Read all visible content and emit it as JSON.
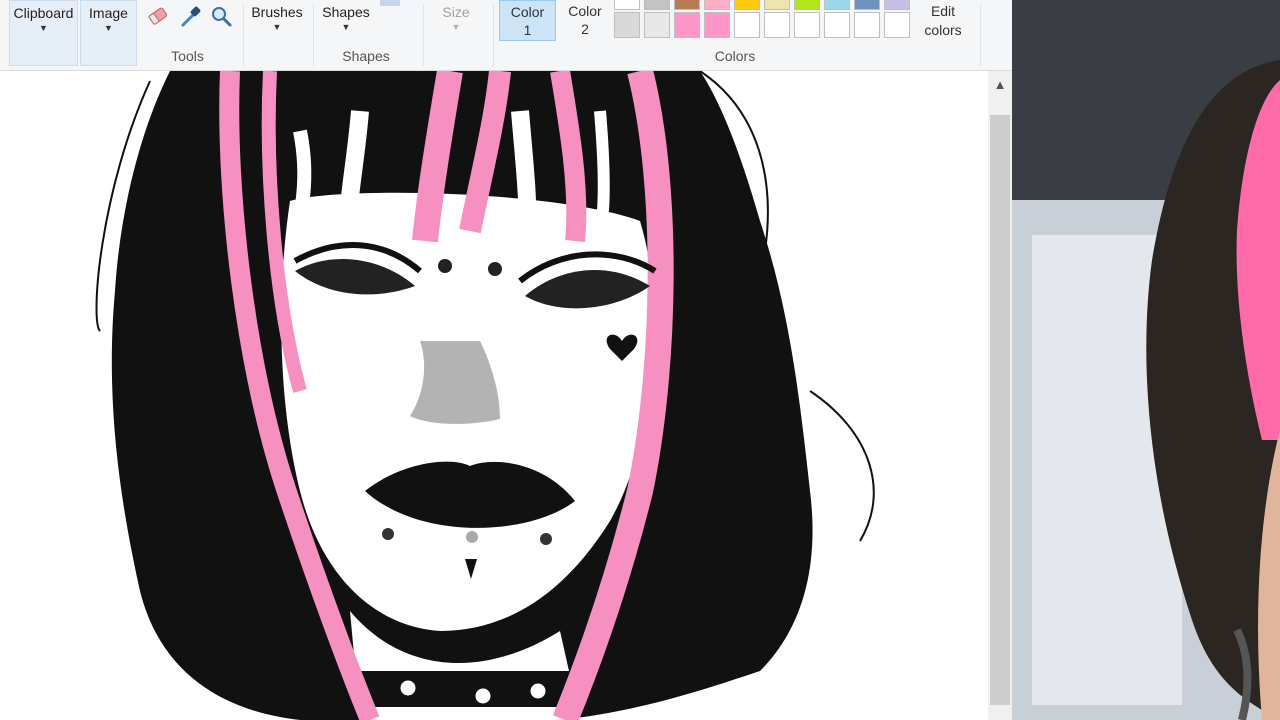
{
  "ribbon": {
    "clipboard_label": "Clipboard",
    "image_label": "Image",
    "tools_group_label": "Tools",
    "brushes_label": "Brushes",
    "shapes_label": "Shapes",
    "shapes_group_label": "Shapes",
    "size_label": "Size",
    "color1_label_line1": "Color",
    "color1_label_line2": "1",
    "color2_label_line1": "Color",
    "color2_label_line2": "2",
    "colors_group_label": "Colors",
    "edit_colors_line1": "Edit",
    "edit_colors_line2": "colors",
    "tool_icons": [
      "eraser-icon",
      "color-picker-icon",
      "magnifier-icon"
    ],
    "palette_row1": [
      "#ffffff",
      "#c3c3c3",
      "#b97a57",
      "#ffaec9",
      "#ffc90e",
      "#efe4b0",
      "#b5e61d",
      "#99d9ea",
      "#7092be",
      "#c8bfe7"
    ],
    "palette_row2": [
      "#d9d9d9",
      "#e8e8e8",
      "#ff96c8",
      "#ff96c8",
      "#ffffff",
      "#ffffff",
      "#ffffff",
      "#ffffff",
      "#ffffff",
      "#ffffff"
    ]
  },
  "canvas": {
    "content": "ink-portrait-drawing",
    "accent_pink": "#f590c0"
  },
  "webcam": {
    "content": "webcam-feed"
  }
}
